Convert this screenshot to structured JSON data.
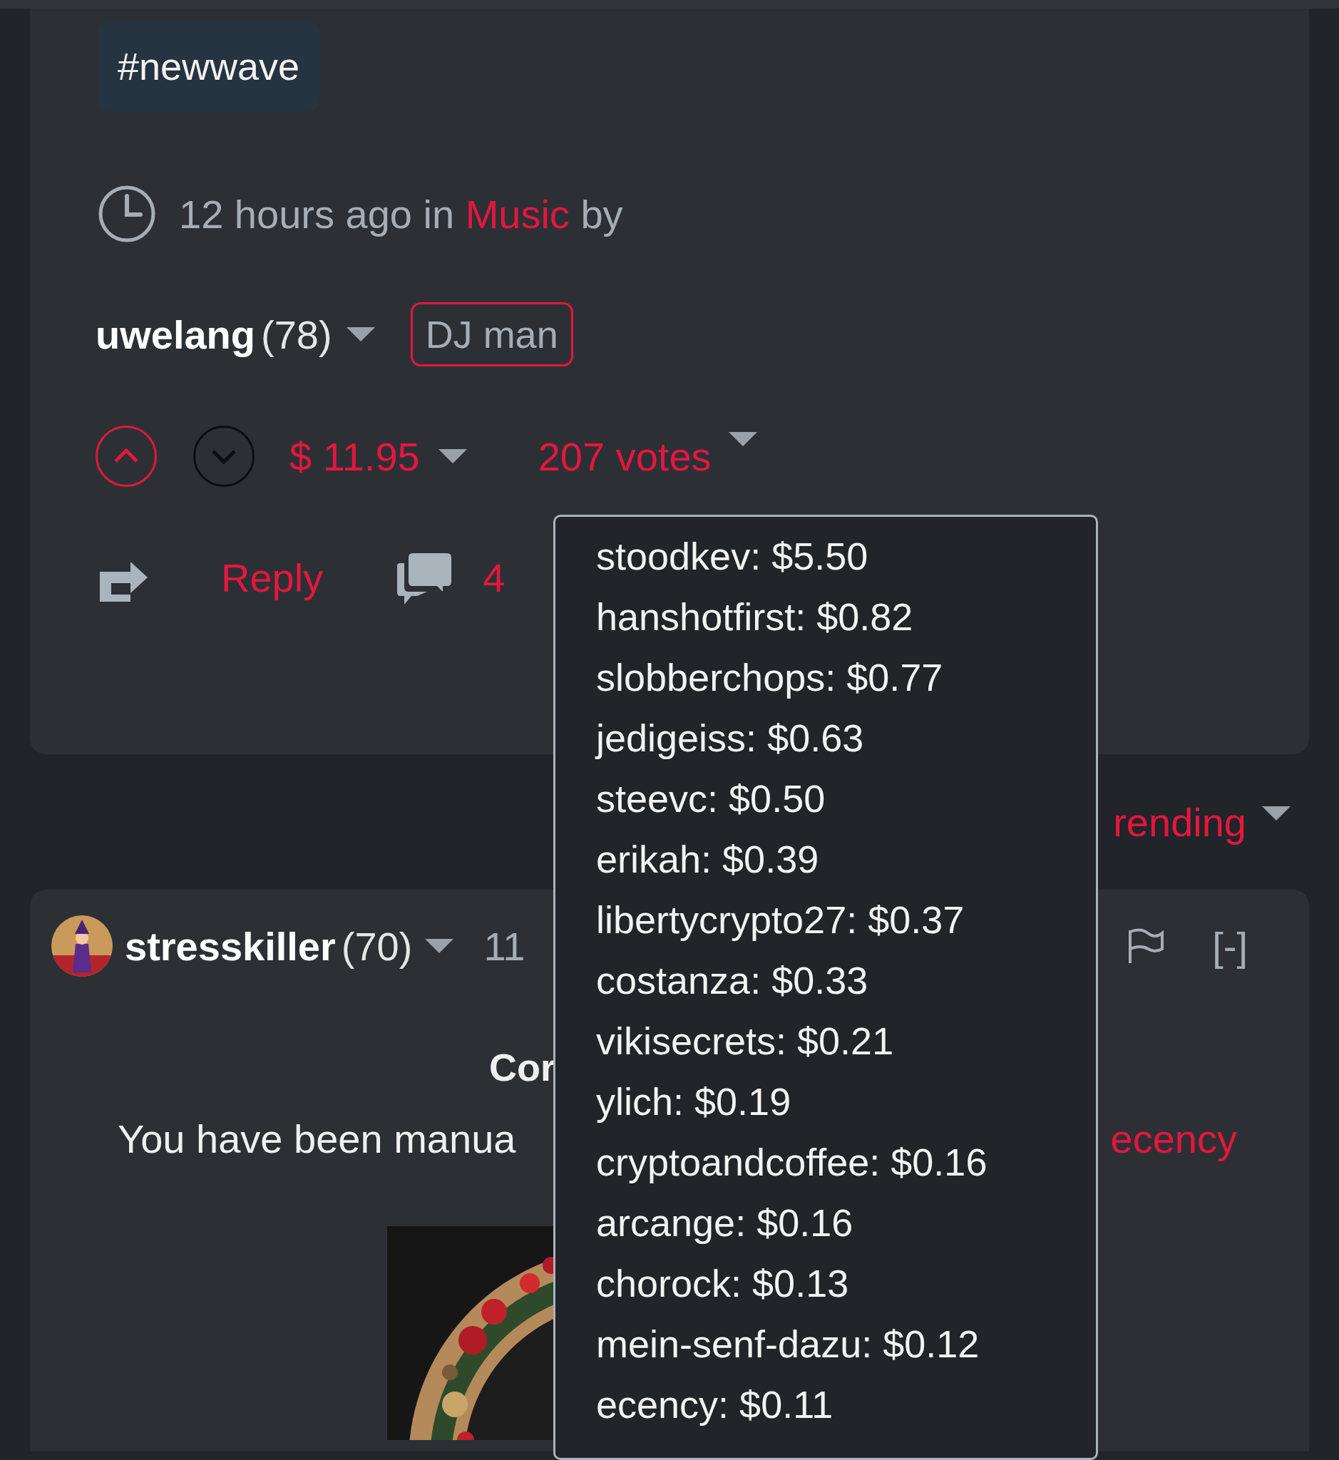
{
  "post": {
    "tags": [
      "#newwave"
    ],
    "time_text": "12 hours ago in",
    "category": "Music",
    "by": "by",
    "author": {
      "name": "uwelang",
      "reputation": "(78)"
    },
    "badge": "DJ man",
    "upvoted": true,
    "payout": "$ 11.95",
    "votes": "207 votes",
    "reply": "Reply",
    "comment_count": "4"
  },
  "sort": {
    "label": "rending"
  },
  "comment": {
    "author": "stresskiller",
    "reputation": "(70)",
    "time": "11",
    "heading": "Cor",
    "body": "You have been manua",
    "link": "ecency",
    "collapse": "[-]"
  },
  "votes_popup": {
    "entries": [
      "stoodkev: $5.50",
      "hanshotfirst: $0.82",
      "slobberchops: $0.77",
      "jedigeiss: $0.63",
      "steevc: $0.50",
      "erikah: $0.39",
      "libertycrypto27: $0.37",
      "costanza: $0.33",
      "vikisecrets: $0.21",
      "ylich: $0.19",
      "cryptoandcoffee: $0.16",
      "arcange: $0.16",
      "chorock: $0.13",
      "mein-senf-dazu: $0.12",
      "ecency: $0.11"
    ]
  }
}
